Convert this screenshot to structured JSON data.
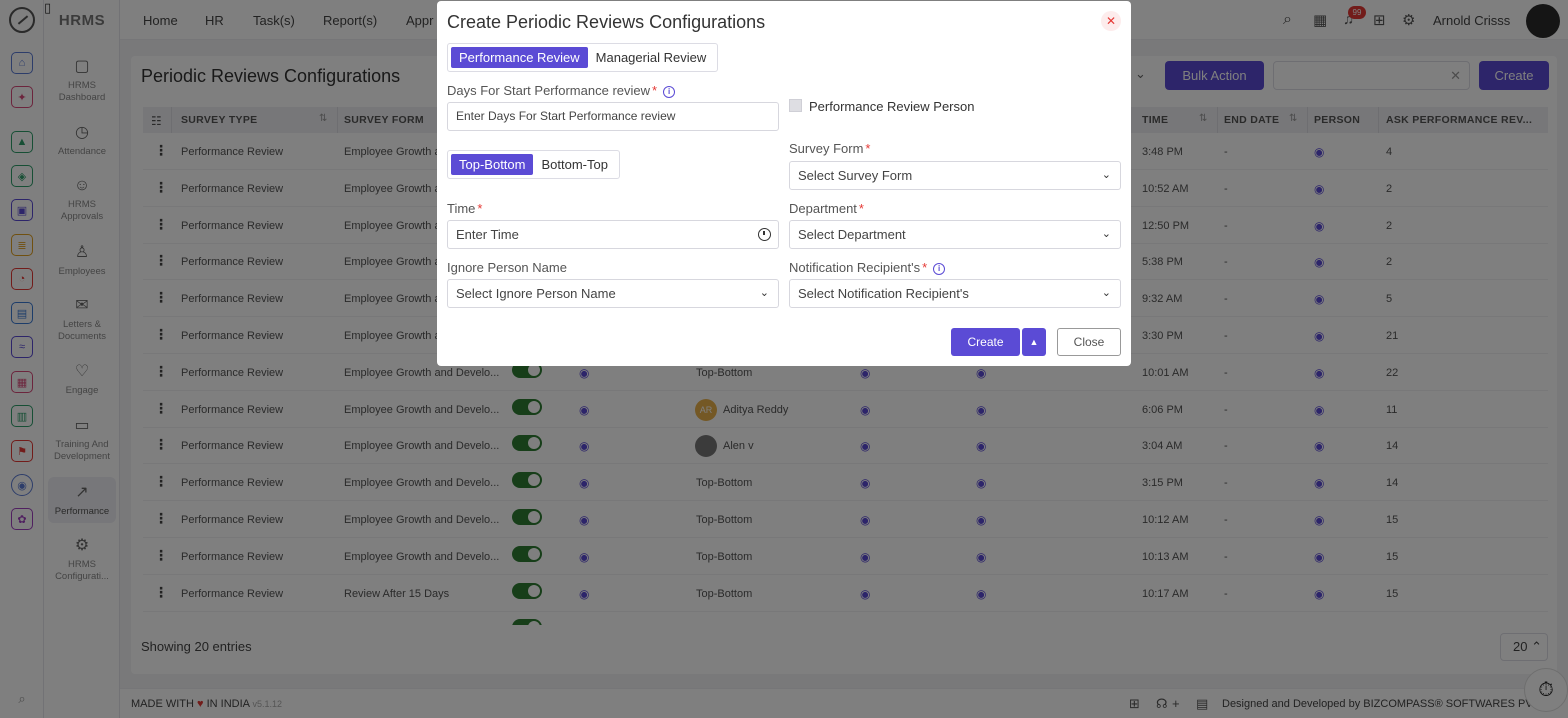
{
  "sidebar": {
    "brand": "HRMS",
    "items": [
      {
        "label": "HRMS Dashboard",
        "icon": "dashboard-icon"
      },
      {
        "label": "Attendance",
        "icon": "calendar-clock-icon"
      },
      {
        "label": "HRMS Approvals",
        "icon": "user-check-icon"
      },
      {
        "label": "Employees",
        "icon": "person-icon"
      },
      {
        "label": "Letters & Documents",
        "icon": "mailbox-icon"
      },
      {
        "label": "Engage",
        "icon": "heart-hands-icon"
      },
      {
        "label": "Training And Development",
        "icon": "presentation-icon"
      },
      {
        "label": "Performance",
        "icon": "trend-chart-icon"
      },
      {
        "label": "HRMS Configurati...",
        "icon": "gear-icon"
      }
    ]
  },
  "topnav": {
    "links": [
      "Home",
      "HR",
      "Task(s)",
      "Report(s)",
      "Appr"
    ],
    "notification_count": "99",
    "user_name": "Arnold Crisss"
  },
  "page": {
    "title": "Periodic Reviews Configurations",
    "bulk_action": "Bulk Action",
    "create": "Create",
    "showing": "Showing 20 entries",
    "page_size": "20"
  },
  "table": {
    "headers": {
      "survey_type": "SURVEY TYPE",
      "survey_form": "SURVEY FORM",
      "time": "TIME",
      "end_date": "END DATE",
      "person": "PERSON",
      "ask": "ASK PERFORMANCE REV..."
    },
    "rows": [
      {
        "type": "Performance Review",
        "form": "Employee Growth a",
        "order": "",
        "time": "3:48 PM",
        "end": "-",
        "ask": "4",
        "toggle": false
      },
      {
        "type": "Performance Review",
        "form": "Employee Growth a",
        "order": "",
        "time": "10:52 AM",
        "end": "-",
        "ask": "2",
        "toggle": false
      },
      {
        "type": "Performance Review",
        "form": "Employee Growth a",
        "order": "",
        "time": "12:50 PM",
        "end": "-",
        "ask": "2",
        "toggle": false
      },
      {
        "type": "Performance Review",
        "form": "Employee Growth a",
        "order": "",
        "time": "5:38 PM",
        "end": "-",
        "ask": "2",
        "toggle": false
      },
      {
        "type": "Performance Review",
        "form": "Employee Growth a",
        "order": "",
        "time": "9:32 AM",
        "end": "-",
        "ask": "5",
        "toggle": false
      },
      {
        "type": "Performance Review",
        "form": "Employee Growth a",
        "order": "",
        "time": "3:30 PM",
        "end": "-",
        "ask": "21",
        "toggle": false
      },
      {
        "type": "Performance Review",
        "form": "Employee Growth and Develo...",
        "order": "Top-Bottom",
        "time": "10:01 AM",
        "end": "-",
        "ask": "22",
        "toggle": true
      },
      {
        "type": "Performance Review",
        "form": "Employee Growth and Develo...",
        "order": "Aditya Reddy",
        "avatar": "AR",
        "time": "6:06 PM",
        "end": "-",
        "ask": "11",
        "toggle": true
      },
      {
        "type": "Performance Review",
        "form": "Employee Growth and Develo...",
        "order": "Alen v",
        "avatar": "",
        "time": "3:04 AM",
        "end": "-",
        "ask": "14",
        "toggle": true
      },
      {
        "type": "Performance Review",
        "form": "Employee Growth and Develo...",
        "order": "Top-Bottom",
        "time": "3:15 PM",
        "end": "-",
        "ask": "14",
        "toggle": true
      },
      {
        "type": "Performance Review",
        "form": "Employee Growth and Develo...",
        "order": "Top-Bottom",
        "time": "10:12 AM",
        "end": "-",
        "ask": "15",
        "toggle": true
      },
      {
        "type": "Performance Review",
        "form": "Employee Growth and Develo...",
        "order": "Top-Bottom",
        "time": "10:13 AM",
        "end": "-",
        "ask": "15",
        "toggle": true
      },
      {
        "type": "Performance Review",
        "form": "Review After 15 Days",
        "order": "Top-Bottom",
        "time": "10:17 AM",
        "end": "-",
        "ask": "15",
        "toggle": true
      }
    ]
  },
  "footer": {
    "made_prefix": "MADE WITH",
    "made_suffix": "IN INDIA",
    "version": "v5.1.12",
    "developed": "Designed and Developed by  BIZCOMPASS® SOFTWARES PV"
  },
  "modal": {
    "title": "Create Periodic Reviews Configurations",
    "review_tabs": [
      "Performance Review",
      "Managerial Review"
    ],
    "days_label": "Days For Start Performance review",
    "days_placeholder": "Enter Days For Start Performance review",
    "perf_person_label": "Performance Review Person",
    "order_tabs": [
      "Top-Bottom",
      "Bottom-Top"
    ],
    "survey_form_label": "Survey Form",
    "survey_form_value": "Select Survey Form",
    "time_label": "Time",
    "time_placeholder": "Enter Time",
    "department_label": "Department",
    "department_value": "Select Department",
    "ignore_label": "Ignore Person Name",
    "ignore_value": "Select Ignore Person Name",
    "recipient_label": "Notification Recipient's",
    "recipient_value": "Select Notification Recipient's",
    "create_label": "Create",
    "close_label": "Close"
  },
  "colors": {
    "accent": "#5b4bd5",
    "danger": "#e53935",
    "toggle_on": "#2e7d32"
  }
}
